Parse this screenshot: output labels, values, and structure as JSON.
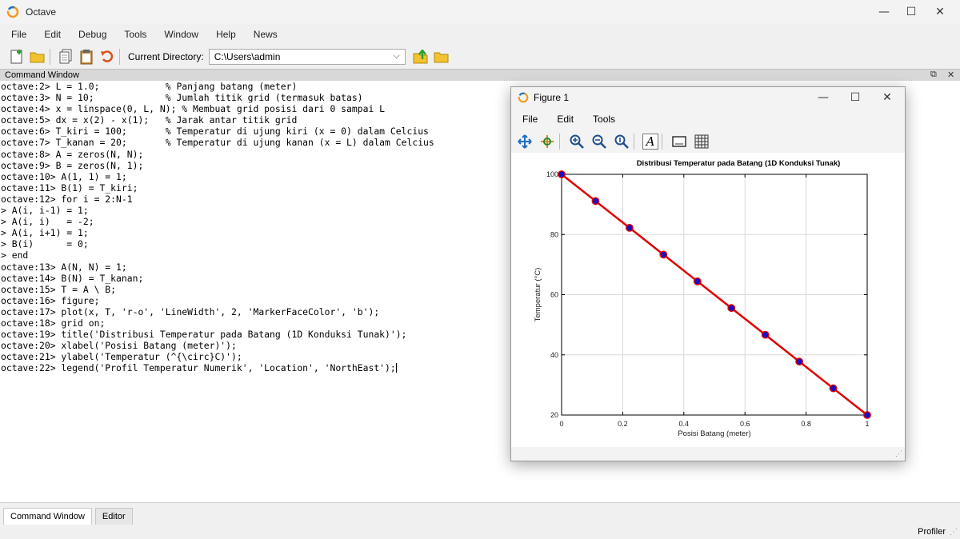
{
  "window": {
    "title": "Octave",
    "min_label": "—",
    "max_label": "☐",
    "close_label": "✕"
  },
  "menu": [
    "File",
    "Edit",
    "Debug",
    "Tools",
    "Window",
    "Help",
    "News"
  ],
  "toolbar": {
    "current_dir_label": "Current Directory:",
    "current_dir_value": "C:\\Users\\admin",
    "icons": [
      "new-script-icon",
      "open-folder-icon",
      "copy-icon",
      "paste-icon",
      "undo-icon",
      "parent-directory-icon",
      "browse-directory-icon"
    ]
  },
  "command_window": {
    "title": "Command Window",
    "lines": [
      "octave:2> L = 1.0;            % Panjang batang (meter)",
      "octave:3> N = 10;             % Jumlah titik grid (termasuk batas)",
      "octave:4> x = linspace(0, L, N); % Membuat grid posisi dari 0 sampai L",
      "octave:5> dx = x(2) - x(1);   % Jarak antar titik grid",
      "octave:6> T_kiri = 100;       % Temperatur di ujung kiri (x = 0) dalam Celcius",
      "octave:7> T_kanan = 20;       % Temperatur di ujung kanan (x = L) dalam Celcius",
      "octave:8> A = zeros(N, N);",
      "octave:9> B = zeros(N, 1);",
      "octave:10> A(1, 1) = 1;",
      "octave:11> B(1) = T_kiri;",
      "octave:12> for i = 2:N-1",
      "> A(i, i-1) = 1;",
      "> A(i, i)   = -2;",
      "> A(i, i+1) = 1;",
      "> B(i)      = 0;",
      "> end",
      "octave:13> A(N, N) = 1;",
      "octave:14> B(N) = T_kanan;",
      "octave:15> T = A \\ B;",
      "octave:16> figure;",
      "octave:17> plot(x, T, 'r-o', 'LineWidth', 2, 'MarkerFaceColor', 'b');",
      "octave:18> grid on;",
      "octave:19> title('Distribusi Temperatur pada Batang (1D Konduksi Tunak)');",
      "octave:20> xlabel('Posisi Batang (meter)');",
      "octave:21> ylabel('Temperatur (^{\\circ}C)');",
      "octave:22> legend('Profil Temperatur Numerik', 'Location', 'NorthEast');"
    ]
  },
  "bottom_tabs": [
    "Command Window",
    "Editor"
  ],
  "status": {
    "profiler": "Profiler"
  },
  "figure": {
    "title": "Figure 1",
    "menu": [
      "File",
      "Edit",
      "Tools"
    ],
    "tool_icons": [
      "pan-icon",
      "rotate-icon",
      "zoom-in-icon",
      "zoom-out-icon",
      "zoom-reset-icon",
      "insert-text-icon",
      "toggle-axes-icon",
      "toggle-grid-icon"
    ],
    "text_tool_label": "A"
  },
  "chart_data": {
    "type": "line",
    "title": "Distribusi Temperatur pada Batang (1D Konduksi Tunak)",
    "xlabel": "Posisi Batang (meter)",
    "ylabel": "Temperatur (°C)",
    "x": [
      0,
      0.1111,
      0.2222,
      0.3333,
      0.4444,
      0.5556,
      0.6667,
      0.7778,
      0.8889,
      1.0
    ],
    "series": [
      {
        "values": [
          100,
          91.11,
          82.22,
          73.33,
          64.44,
          55.56,
          46.67,
          37.78,
          28.89,
          20
        ]
      }
    ],
    "xlim": [
      0,
      1
    ],
    "ylim": [
      20,
      100
    ],
    "xticks": [
      "0",
      "0.2",
      "0.4",
      "0.6",
      "0.8",
      "1"
    ],
    "yticks": [
      "20",
      "40",
      "60",
      "80",
      "100"
    ],
    "grid": true,
    "line_color": "#e00000",
    "marker_color": "#1010c8"
  }
}
